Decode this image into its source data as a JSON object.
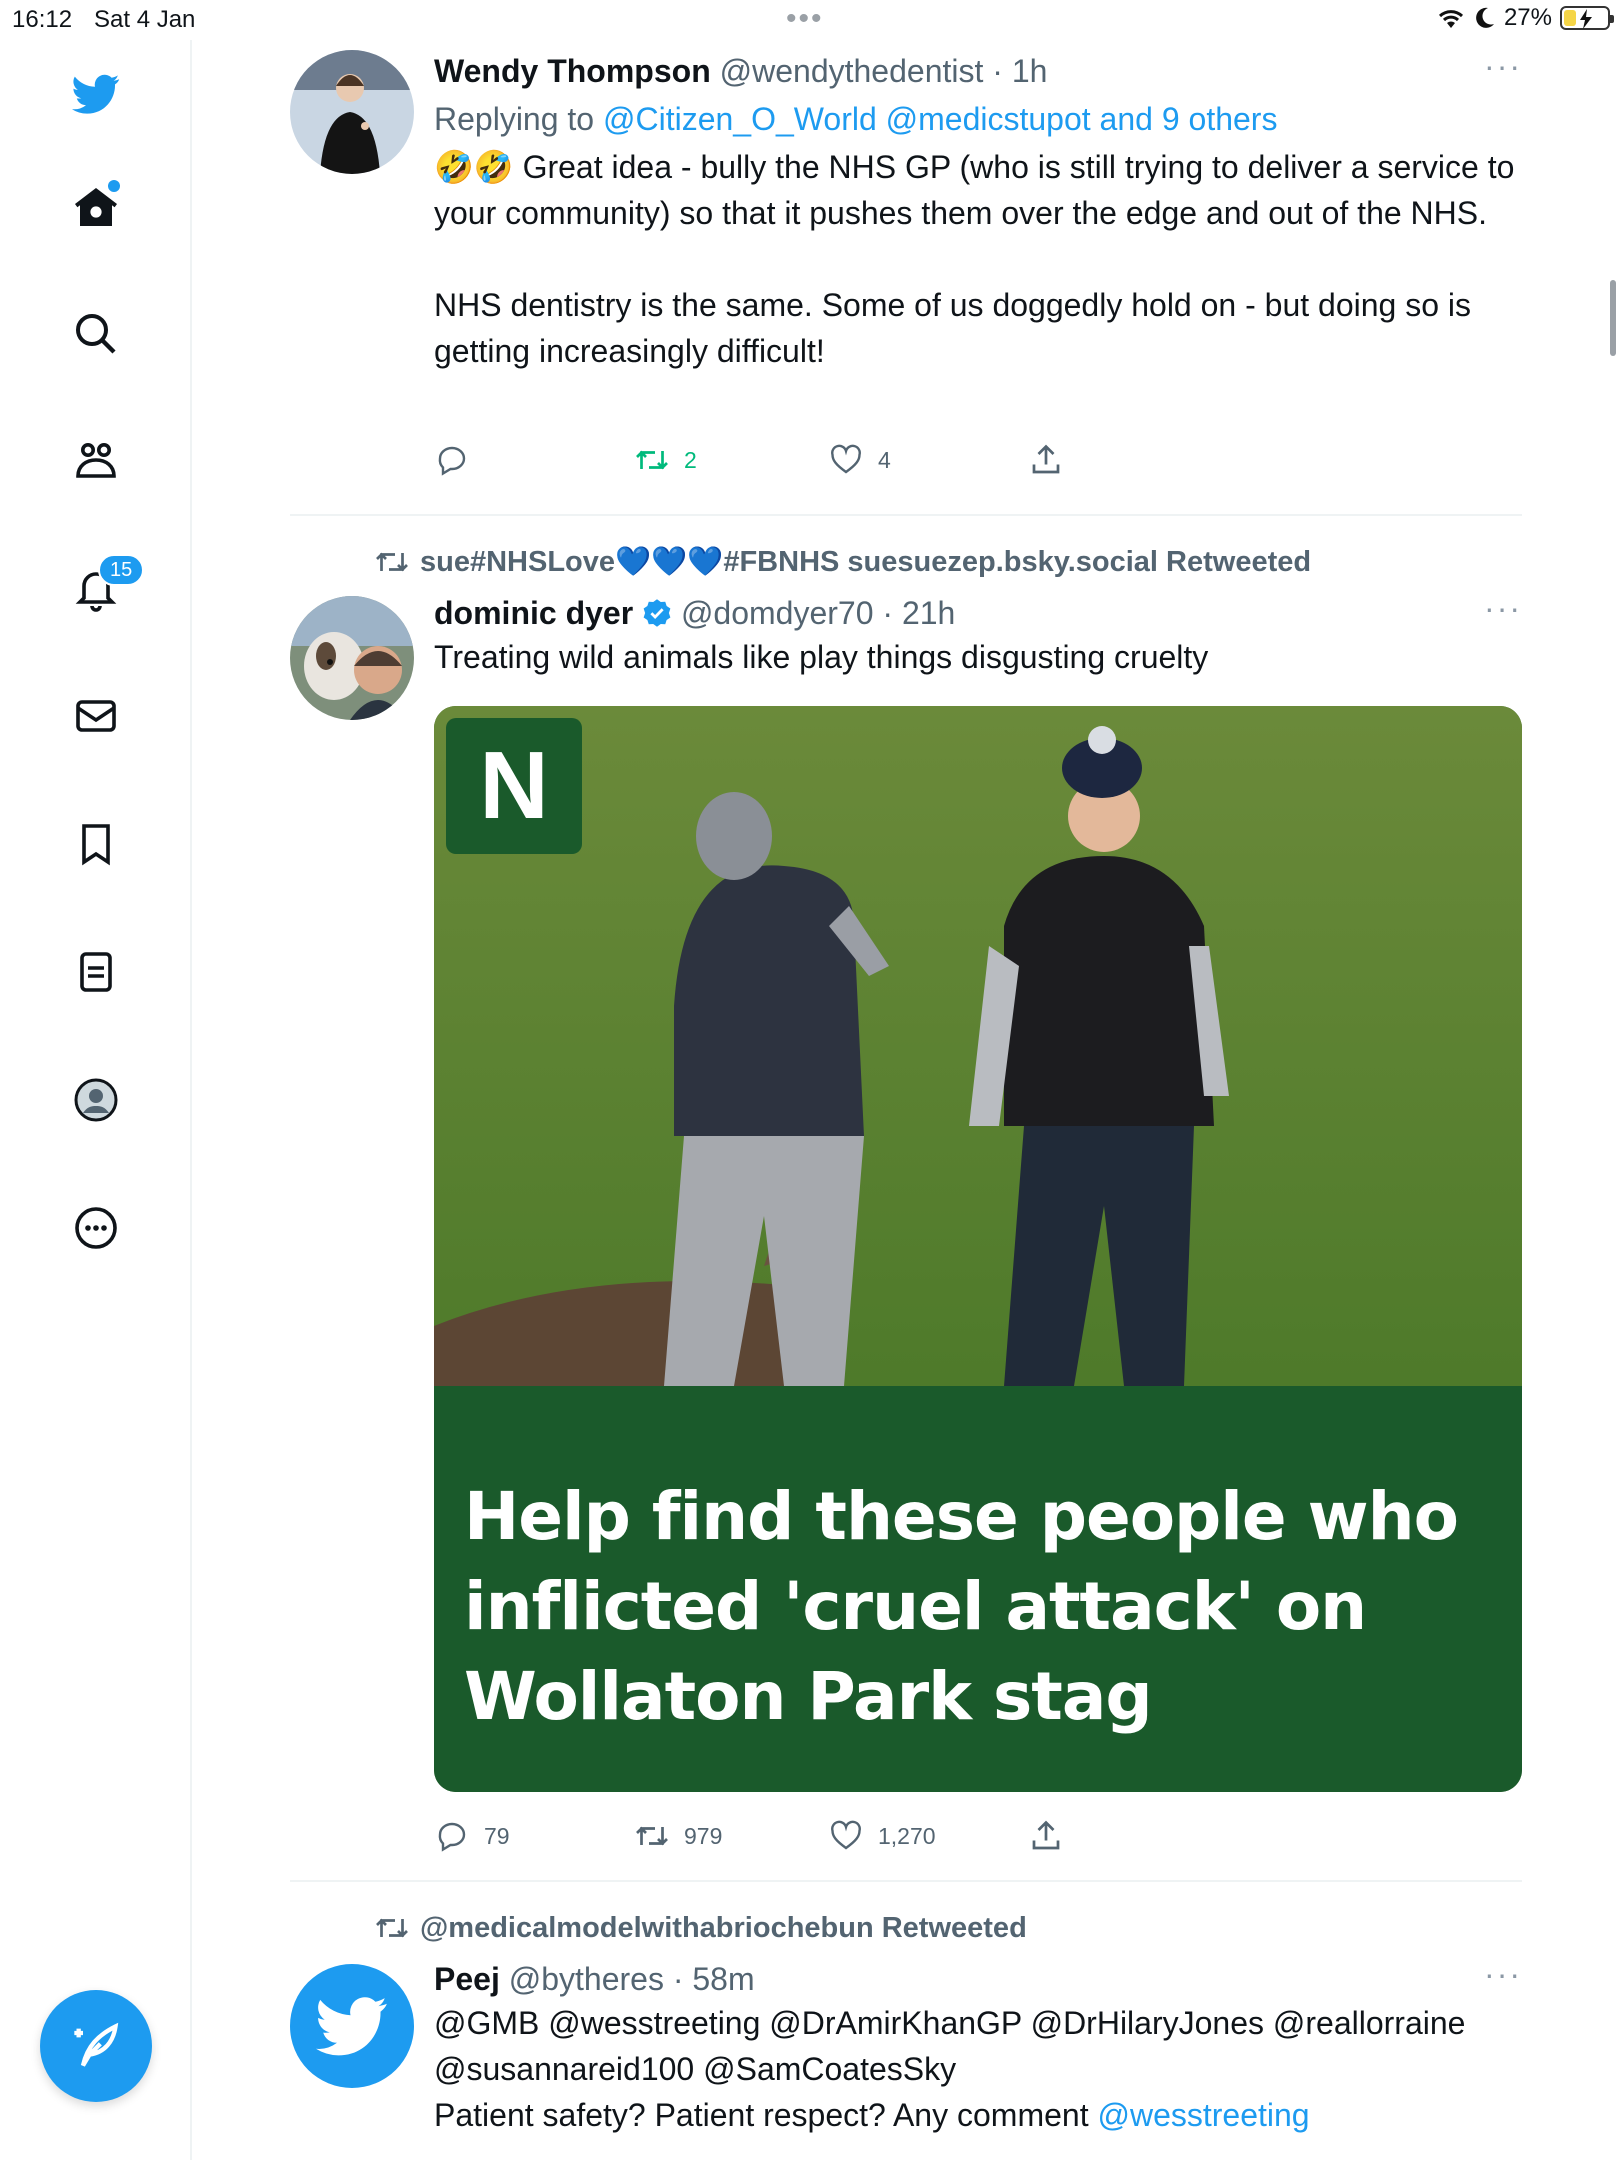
{
  "status_bar": {
    "time": "16:12",
    "date": "Sat 4 Jan",
    "battery": "27%"
  },
  "sidebar": {
    "notifications_badge": "15",
    "items": [
      "logo",
      "home",
      "search",
      "communities",
      "notifications",
      "messages",
      "bookmarks",
      "lists",
      "profile",
      "more"
    ]
  },
  "tweets": [
    {
      "name": "Wendy Thompson",
      "handle": "@wendythedentist",
      "time": "1h",
      "reply_prefix": "Replying to",
      "reply_to": "@Citizen_O_World @medicstupot and 9 others",
      "text_p1": "🤣🤣 Great idea - bully the NHS GP (who is still trying to deliver a service to your community) so that it pushes them over the edge and out of the NHS.",
      "text_p2": "NHS dentistry is the same. Some of us doggedly hold on - but doing so is getting increasingly difficult!",
      "replies": "",
      "retweets": "2",
      "likes": "4"
    },
    {
      "retweeted_by": "sue#NHSLove💙💙💙#FBNHS suesuezep.bsky.social Retweeted",
      "name": "dominic dyer",
      "handle": "@domdyer70",
      "time": "21h",
      "text": "Treating wild animals like play things disgusting cruelty",
      "card_logo": "N",
      "card_headline": "Help find these people who inflicted 'cruel attack' on Wollaton Park stag",
      "replies": "79",
      "retweets": "979",
      "likes": "1,270"
    },
    {
      "retweeted_by": "@medicalmodelwithabriochebun Retweeted",
      "name": "Peej",
      "handle": "@bytheres",
      "time": "58m",
      "mentions_line1": "@GMB @wesstreeting @DrAmirKhanGP @DrHilaryJones @reallorraine",
      "mentions_line2": "@susannareid100 @SamCoatesSky",
      "text": "Patient safety? Patient respect? Any comment",
      "text_mention": "@wesstreeting"
    }
  ],
  "colors": {
    "accent": "#1d9bf0",
    "retweet_green": "#00ba7c",
    "card_green": "#1a5a2b"
  }
}
